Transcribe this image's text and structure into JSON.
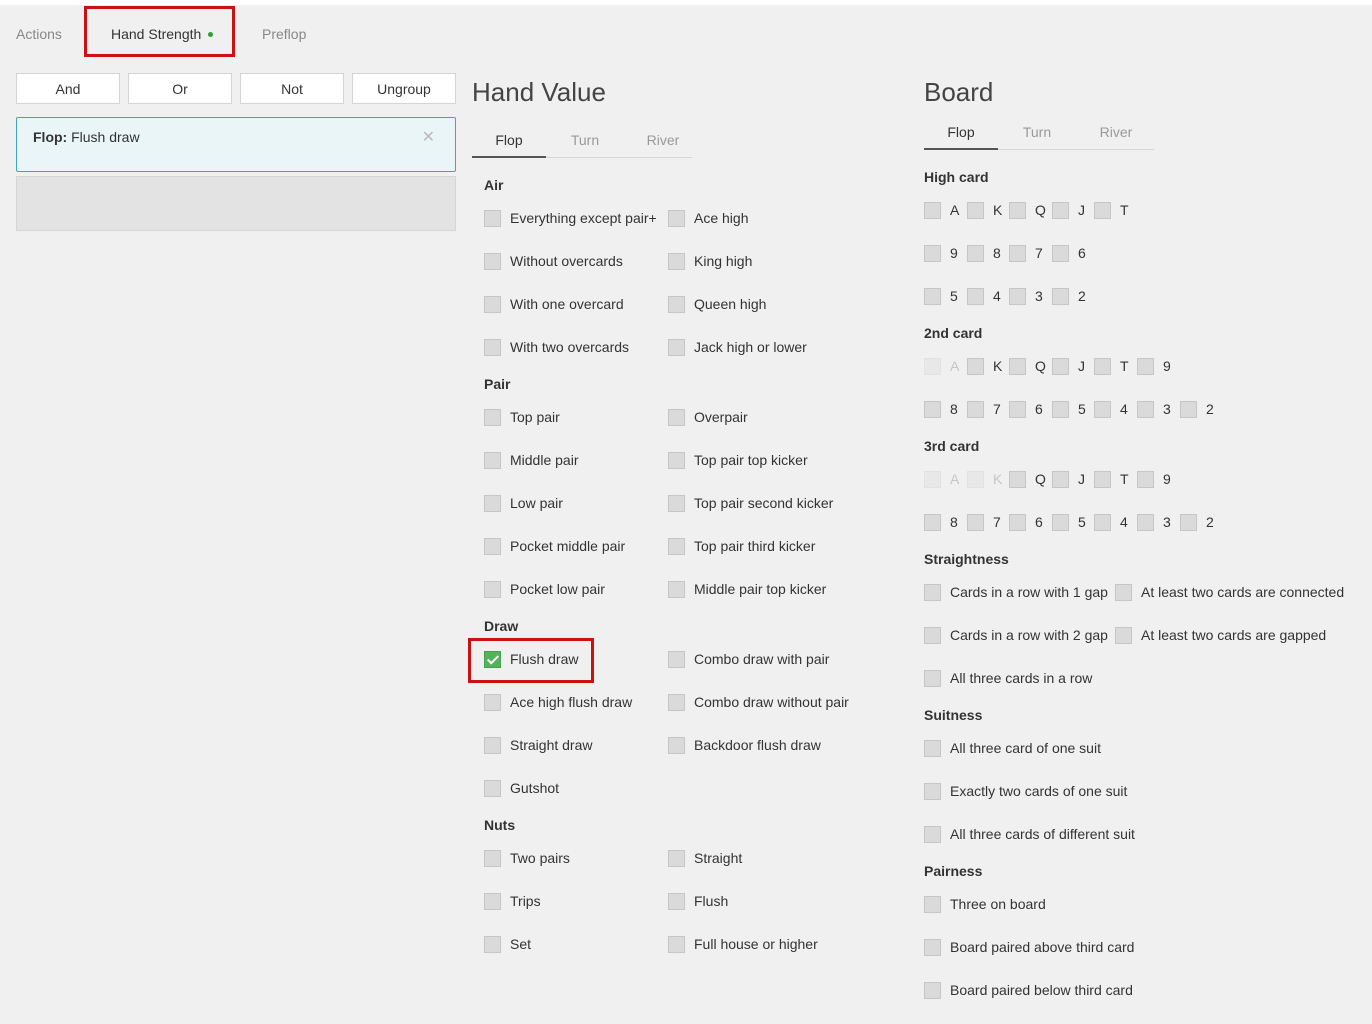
{
  "top_tabs": {
    "actions": "Actions",
    "hand_strength": "Hand Strength",
    "preflop": "Preflop"
  },
  "logic": {
    "and": "And",
    "or": "Or",
    "not": "Not",
    "ungroup": "Ungroup"
  },
  "filter": {
    "street": "Flop:",
    "value": "Flush draw"
  },
  "hand_value": {
    "title": "Hand Value",
    "tabs": [
      "Flop",
      "Turn",
      "River"
    ],
    "sections": {
      "air": {
        "title": "Air",
        "items": [
          "Everything except pair+",
          "Ace high",
          "Without overcards",
          "King high",
          "With one overcard",
          "Queen high",
          "With two overcards",
          "Jack high or lower"
        ]
      },
      "pair": {
        "title": "Pair",
        "items": [
          "Top pair",
          "Overpair",
          "Middle pair",
          "Top pair top kicker",
          "Low pair",
          "Top pair second kicker",
          "Pocket middle pair",
          "Top pair third kicker",
          "Pocket low pair",
          "Middle pair top kicker"
        ]
      },
      "draw": {
        "title": "Draw",
        "items": [
          "Flush draw",
          "Combo draw with pair",
          "Ace high flush draw",
          "Combo draw without pair",
          "Straight draw",
          "Backdoor flush draw",
          "Gutshot"
        ]
      },
      "nuts": {
        "title": "Nuts",
        "items": [
          "Two pairs",
          "Straight",
          "Trips",
          "Flush",
          "Set",
          "Full house or higher"
        ]
      }
    }
  },
  "board": {
    "title": "Board",
    "tabs": [
      "Flop",
      "Turn",
      "River"
    ],
    "high_card": {
      "title": "High card",
      "rows": [
        [
          "A",
          "K",
          "Q",
          "J",
          "T"
        ],
        [
          "9",
          "8",
          "7",
          "6"
        ],
        [
          "5",
          "4",
          "3",
          "2"
        ]
      ]
    },
    "second_card": {
      "title": "2nd card",
      "rows": [
        [
          "A",
          "K",
          "Q",
          "J",
          "T",
          "9"
        ],
        [
          "8",
          "7",
          "6",
          "5",
          "4",
          "3",
          "2"
        ]
      ]
    },
    "third_card": {
      "title": "3rd card",
      "rows": [
        [
          "A",
          "K",
          "Q",
          "J",
          "T",
          "9"
        ],
        [
          "8",
          "7",
          "6",
          "5",
          "4",
          "3",
          "2"
        ]
      ]
    },
    "straightness": {
      "title": "Straightness",
      "items": [
        "Cards in a row with 1 gap",
        "At least two cards are connected",
        "Cards in a row with 2 gap",
        "At least two cards are gapped",
        "All three cards in a row"
      ]
    },
    "suitness": {
      "title": "Suitness",
      "items": [
        "All three card of one suit",
        "Exactly two cards of one suit",
        "All three cards of different suit"
      ]
    },
    "pairness": {
      "title": "Pairness",
      "items": [
        "Three on board",
        "Board paired above third card",
        "Board paired below third card"
      ]
    }
  },
  "colors": {
    "highlight": "#cc1111",
    "checked": "#53b25a",
    "filter_border": "#43a4c0",
    "dot": "#2e9e2e"
  }
}
